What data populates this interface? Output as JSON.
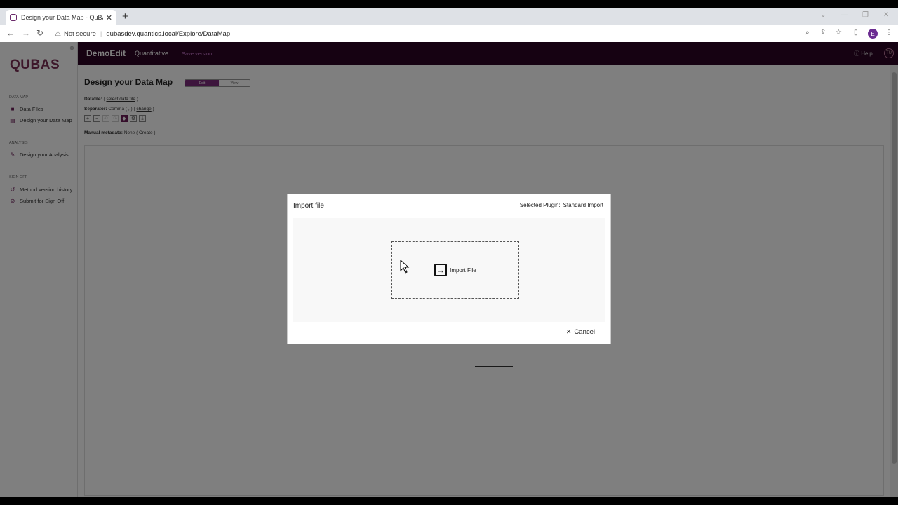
{
  "browser": {
    "tab_title": "Design your Data Map - QuBAS",
    "security_label": "Not secure",
    "url": "qubasdev.quantics.local/Explore/DataMap",
    "profile_initial": "E"
  },
  "sidebar": {
    "logo": "QUBAS",
    "sections": [
      {
        "heading": "DATA MAP",
        "items": [
          "Data Files",
          "Design your Data Map"
        ]
      },
      {
        "heading": "ANALYSIS",
        "items": [
          "Design your Analysis"
        ]
      },
      {
        "heading": "SIGN OFF",
        "items": [
          "Method version history",
          "Submit for Sign Off"
        ]
      }
    ]
  },
  "topbar": {
    "brand": "DemoEdit",
    "nav": "Quantitative",
    "save_version": "Save version",
    "help": "Help",
    "user_initials": "TU"
  },
  "main": {
    "title": "Design your Data Map",
    "toggle_edit": "Edit",
    "toggle_view": "View",
    "datafile_label": "Datafile:",
    "datafile_link": "select data file",
    "separator_label": "Separator:",
    "separator_value": "Comma ( , )",
    "separator_change": "change",
    "metadata_label": "Manual metadata:",
    "metadata_value": "None",
    "metadata_create": "Create"
  },
  "modal": {
    "title": "Import file",
    "plugin_label": "Selected Plugin:",
    "plugin_value": "Standard Import",
    "dropzone_label": "Import File",
    "cancel": "Cancel"
  },
  "colors": {
    "topbar_bg": "#2c0424",
    "accent": "#7b2b7b",
    "save_version": "#c576c9"
  }
}
